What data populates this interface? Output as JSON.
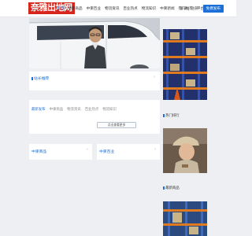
{
  "header": {
    "logo_text": "奈雅出地网",
    "nav": [
      {
        "label": "首页"
      },
      {
        "label": "中柬商品"
      },
      {
        "label": "中柬百业"
      },
      {
        "label": "物流资讯"
      },
      {
        "label": "百业热点"
      },
      {
        "label": "物流知识"
      },
      {
        "label": "中柬新闻"
      },
      {
        "label": "热门推荐"
      }
    ],
    "more_label": "平台介绍 ▾",
    "login_label": "登录",
    "separator": "|",
    "register_label": "注册",
    "publish_button": "免费发布"
  },
  "recommend": {
    "title": "站长推荐"
  },
  "latest": {
    "tabs": [
      {
        "label": "最新发布"
      },
      {
        "label": "中柬商品"
      },
      {
        "label": "物流资讯"
      },
      {
        "label": "百业热点"
      },
      {
        "label": "物流知识"
      }
    ],
    "load_more_label": "点击查看更多"
  },
  "bottom_cards": [
    {
      "title": "中柬商品"
    },
    {
      "title": "中柬百业"
    }
  ],
  "sidebar": {
    "hot_label": "热门排行",
    "news_label": "最新商品"
  },
  "colors": {
    "accent": "#1b6fd6",
    "logo_red": "#d8261c",
    "background": "#eeeff2"
  }
}
